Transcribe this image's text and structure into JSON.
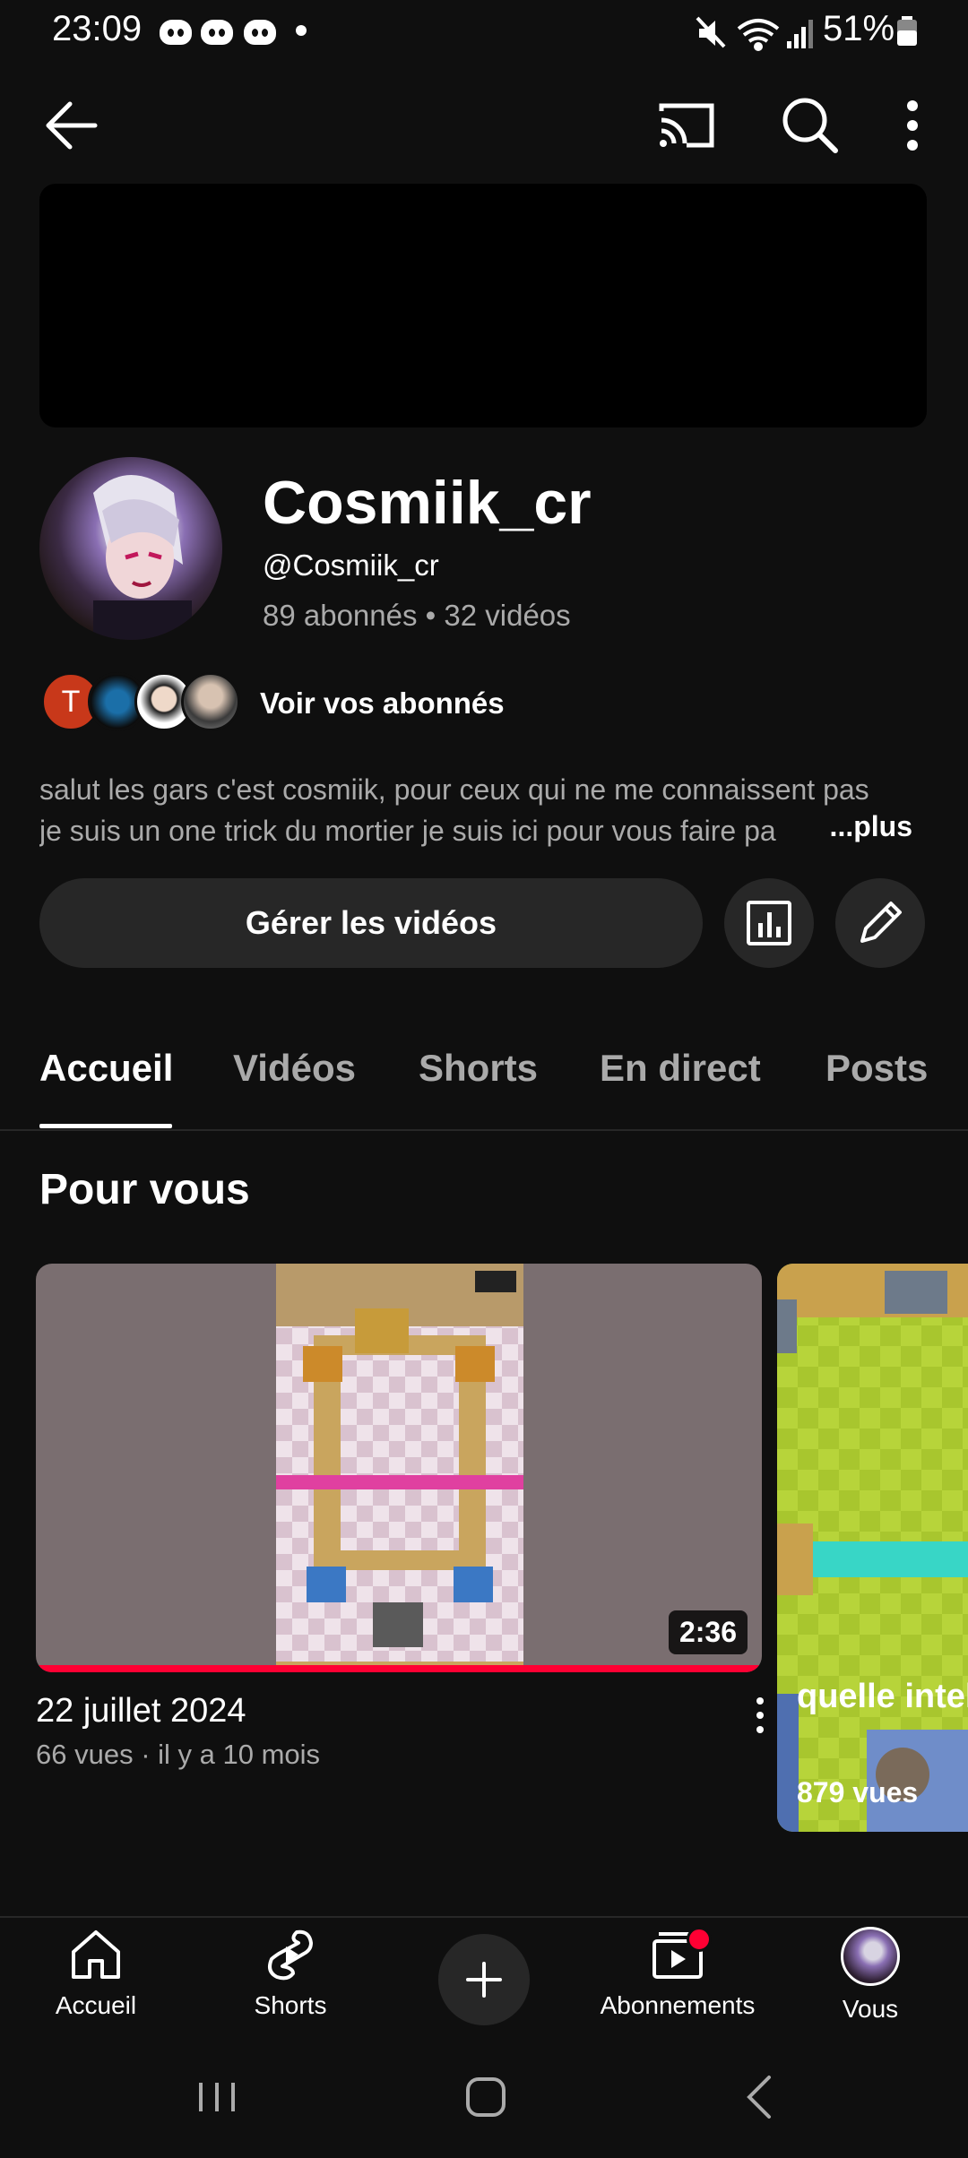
{
  "status_bar": {
    "time": "23:09",
    "battery": "51%"
  },
  "channel": {
    "name": "Cosmiik_cr",
    "handle": "@Cosmiik_cr",
    "stats": "89 abonnés • 32 vidéos",
    "subscribers_link": "Voir vos abonnés",
    "first_subscriber_initial": "T",
    "description_line1": "salut les gars c'est cosmiik, pour ceux qui ne me connaissent pas",
    "description_line2": "je suis un one trick du mortier je suis ici pour vous faire pa",
    "description_more": "...plus",
    "manage_button": "Gérer les vidéos"
  },
  "tabs": [
    "Accueil",
    "Vidéos",
    "Shorts",
    "En direct",
    "Posts"
  ],
  "section": {
    "title": "Pour vous"
  },
  "videos": [
    {
      "title": "22 juillet 2024",
      "meta": "66 vues · il y a 10 mois",
      "duration": "2:36",
      "progress": 1.0
    },
    {
      "title": "quelle intel jeu",
      "views": "879 vues"
    }
  ],
  "bottom_nav": {
    "home": "Accueil",
    "shorts": "Shorts",
    "subscriptions": "Abonnements",
    "you": "Vous"
  },
  "colors": {
    "background": "#0f0f0f",
    "accent": "#ff0033",
    "surface": "#272727"
  }
}
